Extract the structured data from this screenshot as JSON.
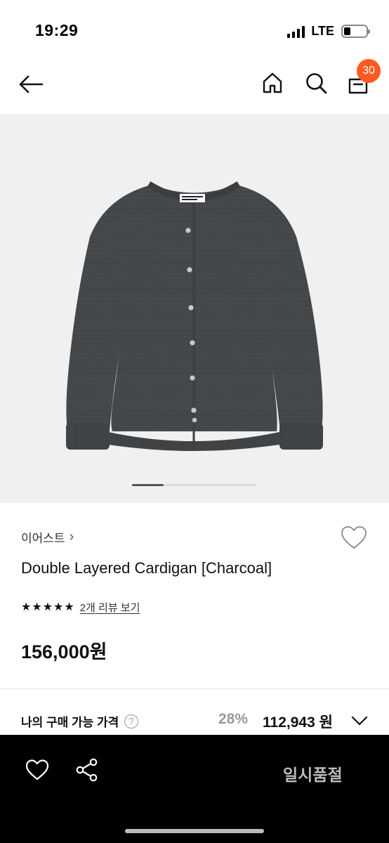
{
  "status_bar": {
    "time": "19:29",
    "network": "LTE",
    "signal_bars": 4,
    "battery_level": 0.3
  },
  "nav": {
    "back_icon": "arrow-left-icon",
    "home_icon": "home-icon",
    "search_icon": "search-icon",
    "cart_icon": "cart-icon",
    "cart_badge": "30",
    "badge_color": "#ff5a1f"
  },
  "gallery": {
    "image_alt": "charcoal knit cardigan",
    "page_index": 1,
    "page_count": 4
  },
  "product": {
    "brand": "이어스트",
    "brand_chevron": "›",
    "name": "Double Layered Cardigan [Charcoal]",
    "rating_stars": 5,
    "review_link": "2개 리뷰 보기",
    "price": "156,000원"
  },
  "my_price": {
    "label": "나의 구매 가능 가격",
    "help_icon": "?",
    "discount": "28%",
    "value": "112,943 원"
  },
  "bottom_bar": {
    "heart_icon": "heart-icon",
    "share_icon": "share-icon",
    "soldout_label": "일시품절"
  },
  "colors": {
    "background": "#ffffff",
    "gallery_bg": "#f0f0f0",
    "bottom_bar": "#000000",
    "muted_text": "#999999"
  }
}
